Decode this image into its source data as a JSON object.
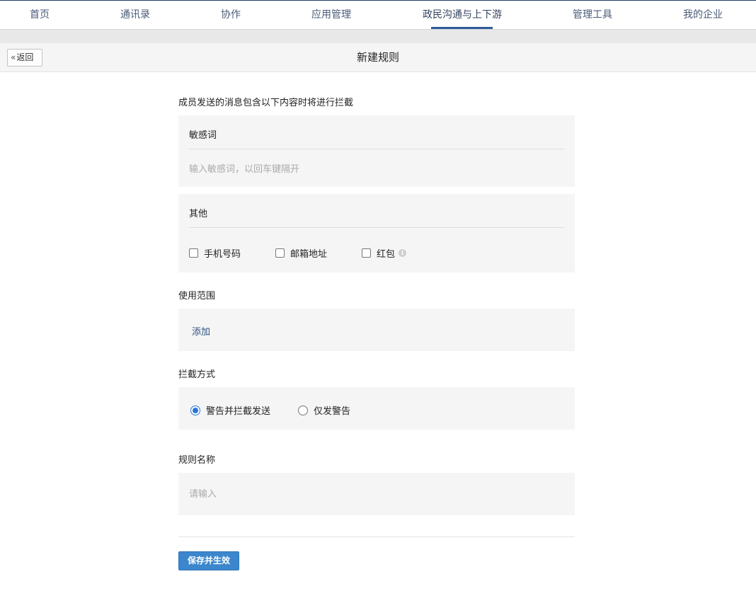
{
  "topnav": {
    "items": [
      {
        "label": "首页"
      },
      {
        "label": "通讯录"
      },
      {
        "label": "协作"
      },
      {
        "label": "应用管理"
      },
      {
        "label": "政民沟通与上下游",
        "active": true
      },
      {
        "label": "管理工具"
      },
      {
        "label": "我的企业"
      }
    ]
  },
  "header": {
    "back_label": "返回",
    "title": "新建规则"
  },
  "form": {
    "intro": "成员发送的消息包含以下内容时将进行拦截",
    "sensitive": {
      "title": "敏感词",
      "placeholder": "输入敏感词，以回车键隔开"
    },
    "other": {
      "title": "其他",
      "options": [
        {
          "label": "手机号码",
          "checked": false
        },
        {
          "label": "邮箱地址",
          "checked": false
        },
        {
          "label": "红包",
          "checked": false,
          "has_info": true
        }
      ],
      "info_glyph": "i"
    },
    "scope": {
      "label": "使用范围",
      "add_label": "添加"
    },
    "method": {
      "label": "拦截方式",
      "options": [
        {
          "label": "警告并拦截发送",
          "checked": true
        },
        {
          "label": "仅发警告",
          "checked": false
        }
      ]
    },
    "rule_name": {
      "label": "规则名称",
      "placeholder": "请输入"
    },
    "save_label": "保存并生效"
  },
  "colors": {
    "accent": "#3b86cc",
    "nav_underline": "#2e5b9a",
    "radio_checked": "#2b75d9",
    "link": "#2e4f80"
  }
}
